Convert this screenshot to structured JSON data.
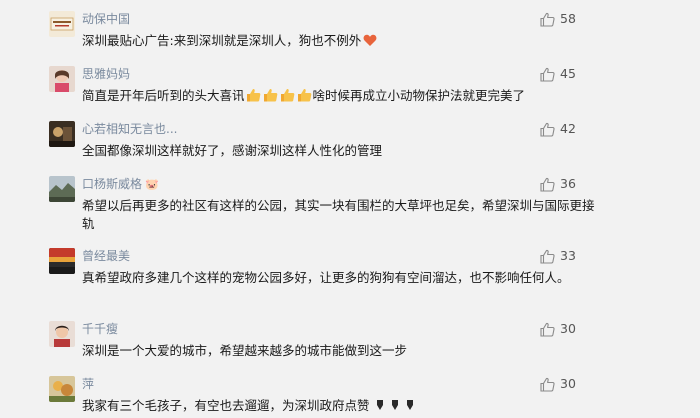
{
  "comments": [
    {
      "username": "动保中国",
      "text": "深圳最贴心广告:来到深圳就是深圳人，狗也不例外",
      "likes": "58",
      "avatar": "logo-avatar",
      "trailing_emoji": "heart-emoji"
    },
    {
      "username": "思雅妈妈",
      "text_before": "简直是开年后听到的头大喜讯",
      "text_after": "啥时候再成立小动物保护法就更完美了",
      "likes": "45",
      "avatar": "girl-avatar",
      "inline_emoji": "thumbs-up-emoji",
      "inline_emoji_count": 4
    },
    {
      "username": "心若相知无言也...",
      "text": "全国都像深圳这样就好了，感谢深圳这样人性化的管理",
      "likes": "42",
      "avatar": "photo-avatar"
    },
    {
      "username": "口杨斯威格",
      "username_badge": "🐷",
      "text": "希望以后再更多的社区有这样的公园，其实一块有围栏的大草坪也足矣，希望深圳与国际更接轨",
      "likes": "36",
      "avatar": "landscape-avatar"
    },
    {
      "username": "曾经最美",
      "text": "真希望政府多建几个这样的宠物公园多好，让更多的狗狗有空间溜达，也不影响任何人。",
      "likes": "33",
      "avatar": "sunset-avatar"
    },
    {
      "username": "千千瘦",
      "text": "深圳是一个大爱的城市，希望越来越多的城市能做到这一步",
      "likes": "30",
      "avatar": "portrait-avatar"
    },
    {
      "username": "萍",
      "text": "我家有三个毛孩子，有空也去遛遛，为深圳政府点赞",
      "likes": "30",
      "avatar": "flower-avatar",
      "trailing_emoji": "pointing-emoji",
      "trailing_emoji_count": 3
    }
  ],
  "colors": {
    "background": "#f2f2f2",
    "username": "#7a8a9e",
    "text": "#1a1a1a",
    "like_icon": "#8a8a8a"
  }
}
